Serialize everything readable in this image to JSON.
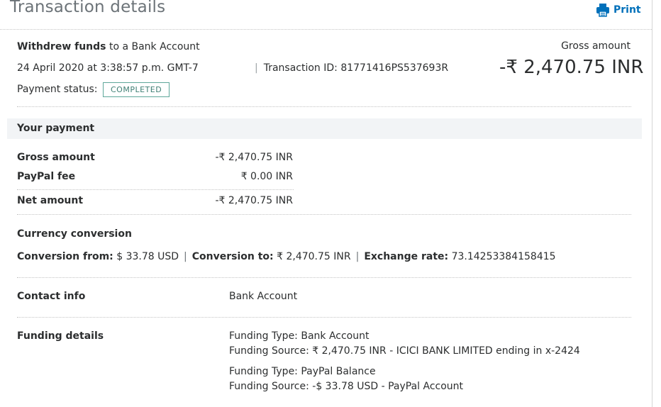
{
  "header": {
    "title": "Transaction details",
    "print_label": "Print"
  },
  "transaction": {
    "action_bold": "Withdrew funds",
    "action_rest": " to a Bank Account",
    "datetime": "24 April 2020 at 3:38:57 p.m. GMT-7",
    "id_label": "Transaction ID: 81771416PS537693R",
    "status_label": "Payment status:",
    "status_value": "COMPLETED",
    "gross_label": "Gross amount",
    "gross_value": "-₹ 2,470.75 INR"
  },
  "your_payment": {
    "section_title": "Your payment",
    "rows": [
      {
        "label": "Gross amount",
        "value": "-₹ 2,470.75 INR"
      },
      {
        "label": "PayPal fee",
        "value": "₹ 0.00 INR"
      },
      {
        "label": "Net amount",
        "value": "-₹ 2,470.75 INR"
      }
    ]
  },
  "currency_conversion": {
    "title": "Currency conversion",
    "from_label": "Conversion from:",
    "from_value": "$ 33.78 USD",
    "to_label": "Conversion to:",
    "to_value": "₹ 2,470.75 INR",
    "rate_label": "Exchange rate:",
    "rate_value": "73.14253384158415",
    "separator": "|"
  },
  "contact_info": {
    "label": "Contact info",
    "value": "Bank Account"
  },
  "funding_details": {
    "label": "Funding details",
    "entries": [
      {
        "type": "Funding Type: Bank Account",
        "source": "Funding Source: ₹ 2,470.75 INR - ICICI BANK LIMITED ending in x-2424"
      },
      {
        "type": "Funding Type: PayPal Balance",
        "source": "Funding Source: -$ 33.78 USD - PayPal Account"
      }
    ]
  },
  "colors": {
    "link": "#0070ba",
    "badge_border": "#5ea79a",
    "section_band": "#f2f4f6"
  }
}
